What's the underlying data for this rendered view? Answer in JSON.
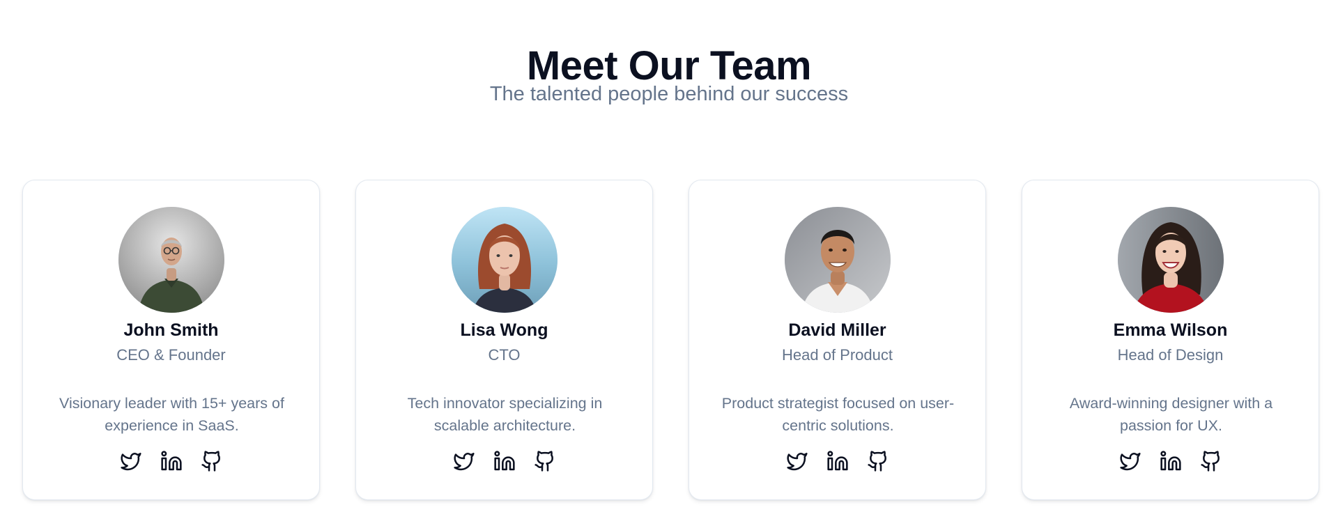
{
  "header": {
    "title": "Meet Our Team",
    "subtitle": "The talented people behind our success"
  },
  "team": [
    {
      "name": "John Smith",
      "role": "CEO & Founder",
      "bio": "Visionary leader with 15+ years of experience in SaaS.",
      "avatar": "portrait-john-smith",
      "socials": [
        "twitter-icon",
        "linkedin-icon",
        "github-icon"
      ]
    },
    {
      "name": "Lisa Wong",
      "role": "CTO",
      "bio": "Tech innovator specializing in scalable architecture.",
      "avatar": "portrait-lisa-wong",
      "socials": [
        "twitter-icon",
        "linkedin-icon",
        "github-icon"
      ]
    },
    {
      "name": "David Miller",
      "role": "Head of Product",
      "bio": "Product strategist focused on user-centric solutions.",
      "avatar": "portrait-david-miller",
      "socials": [
        "twitter-icon",
        "linkedin-icon",
        "github-icon"
      ]
    },
    {
      "name": "Emma Wilson",
      "role": "Head of Design",
      "bio": "Award-winning designer with a passion for UX.",
      "avatar": "portrait-emma-wilson",
      "socials": [
        "twitter-icon",
        "linkedin-icon",
        "github-icon"
      ]
    }
  ],
  "colors": {
    "heading": "#0b1020",
    "muted_text": "#64748b",
    "card_border": "#e2e8f0",
    "background": "#ffffff"
  }
}
